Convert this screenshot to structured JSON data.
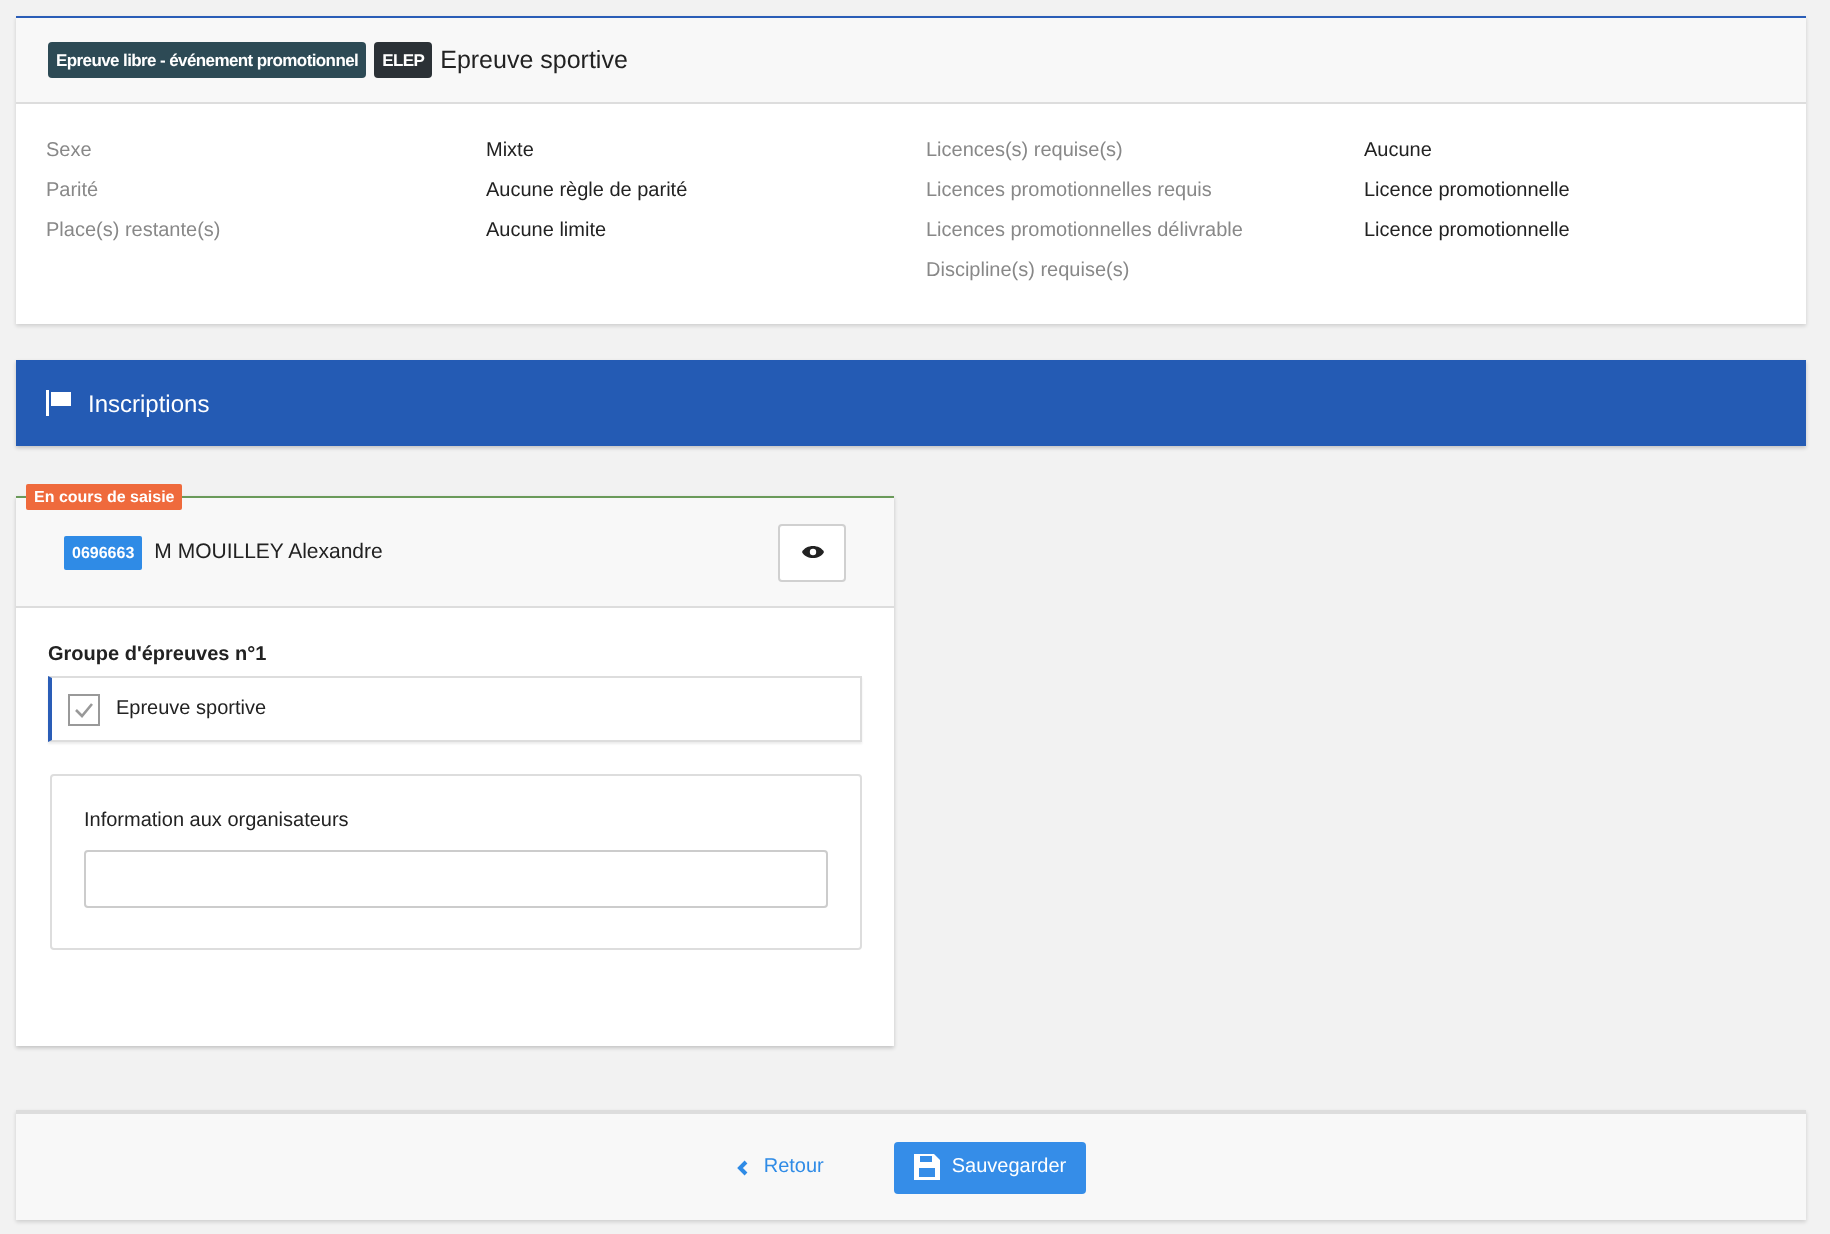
{
  "event": {
    "tags": [
      {
        "label": "Epreuve libre - événement promotionnel",
        "kind": "type"
      },
      {
        "label": "ELEP",
        "kind": "code"
      }
    ],
    "title": "Epreuve sportive",
    "details_left": [
      {
        "label": "Sexe",
        "value": "Mixte"
      },
      {
        "label": "Parité",
        "value": "Aucune règle de parité"
      },
      {
        "label": "Place(s) restante(s)",
        "value": "Aucune limite"
      }
    ],
    "details_right": [
      {
        "label": "Licences(s) requise(s)",
        "value": "Aucune"
      },
      {
        "label": "Licences promotionnelles requis",
        "value": "Licence promotionnelle"
      },
      {
        "label": "Licences promotionnelles délivrable",
        "value": "Licence promotionnelle"
      },
      {
        "label": "Discipline(s) requise(s)"
      }
    ]
  },
  "section": {
    "title": "Inscriptions"
  },
  "registration": {
    "status": "En cours de saisie",
    "licence": "0696663",
    "name": "M MOUILLEY Alexandre",
    "group_title": "Groupe d'épreuves n°1",
    "events": [
      {
        "label": "Epreuve sportive",
        "checked": true
      }
    ],
    "info_label": "Information aux organisateurs"
  },
  "footer": {
    "back": "Retour",
    "save": "Sauvegarder"
  }
}
